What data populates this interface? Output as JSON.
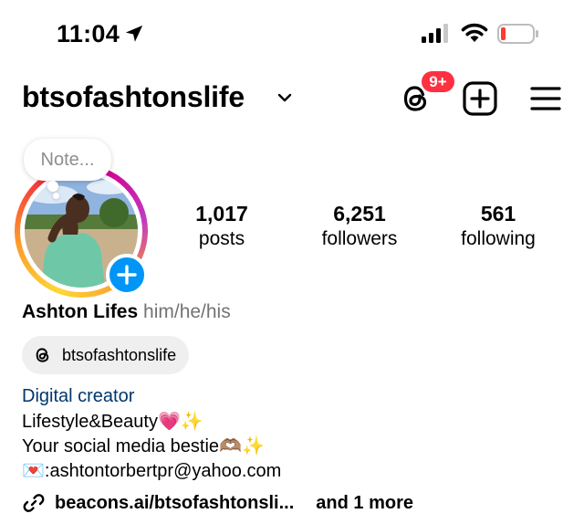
{
  "status_bar": {
    "time": "11:04"
  },
  "header": {
    "username": "btsofashtonslife",
    "threads_badge": "9+"
  },
  "note": {
    "placeholder": "Note..."
  },
  "stats": [
    {
      "value": "1,017",
      "label": "posts"
    },
    {
      "value": "6,251",
      "label": "followers"
    },
    {
      "value": "561",
      "label": "following"
    }
  ],
  "profile": {
    "name": "Ashton Lifes",
    "pronouns": "him/he/his",
    "threads_handle": "btsofashtonslife",
    "category": "Digital creator",
    "bio_line1": "Lifestyle&Beauty💗✨",
    "bio_line2": "Your social media bestie🫶🏽✨",
    "bio_line3": "💌:ashtontorbertpr@yahoo.com",
    "link": "beacons.ai/btsofashtonsli...",
    "link_more": "and 1 more"
  },
  "colors": {
    "badge": "#ff3040",
    "accent_blue": "#0095f6",
    "category": "#00376b",
    "pronouns": "#737373"
  }
}
